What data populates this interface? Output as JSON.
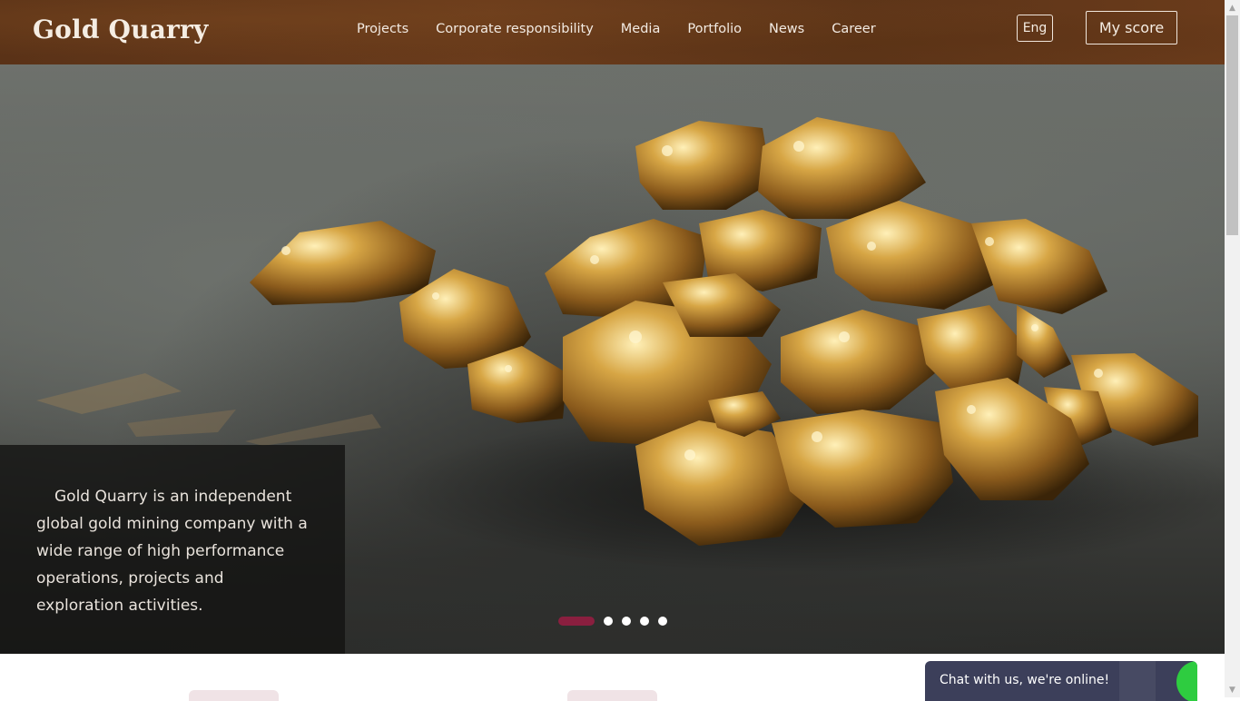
{
  "header": {
    "logo": "Gold Quarry",
    "nav": [
      "Projects",
      "Corporate responsibility",
      "Media",
      "Portfolio",
      "News",
      "Career"
    ],
    "lang_label": "Eng",
    "score_label": "My score"
  },
  "hero": {
    "caption": "Gold Quarry is an independent global gold mining company with a wide range of high performance operations, projects and exploration activities.",
    "slides_total": 5,
    "active_slide": 1
  },
  "chat": {
    "label": "Chat with us, we're online!",
    "status_color": "#2ecc40"
  },
  "colors": {
    "accent": "#8a1f3f",
    "header_brown": "#5e3519"
  }
}
